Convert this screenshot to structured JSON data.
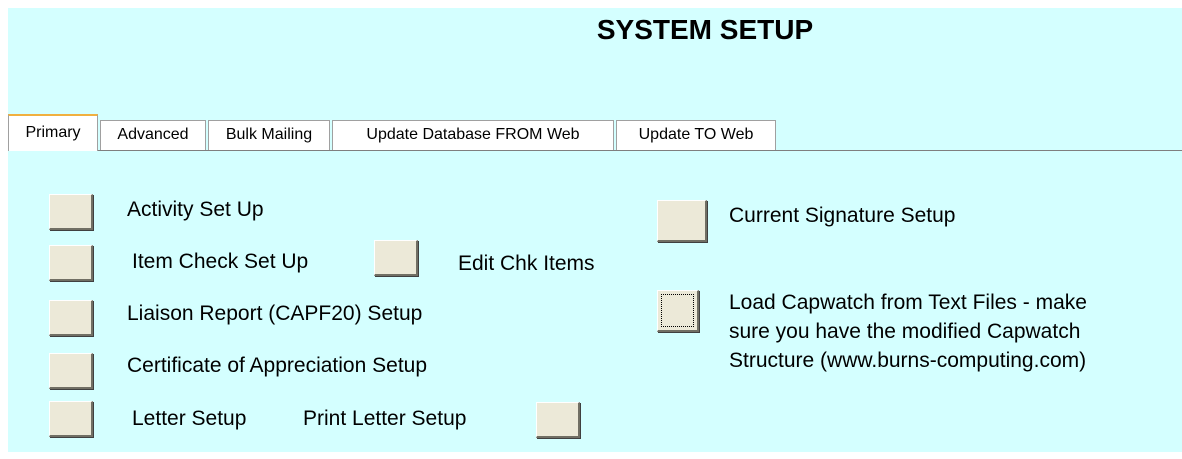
{
  "window": {
    "title": "SYSTEM SETUP"
  },
  "tabs": [
    {
      "label": "Primary",
      "active": true
    },
    {
      "label": "Advanced",
      "active": false
    },
    {
      "label": "Bulk Mailing",
      "active": false
    },
    {
      "label": "Update Database FROM Web",
      "active": false
    },
    {
      "label": "Update TO Web",
      "active": false
    }
  ],
  "primary": {
    "activity_label": "Activity Set Up",
    "item_check_label": "Item Check Set Up",
    "edit_chk_items_label": "Edit Chk Items",
    "liaison_label": "Liaison Report (CAPF20) Setup",
    "certificate_label": "Certificate of  Appreciation Setup",
    "letter_label": "Letter Setup",
    "print_letter_label": "Print Letter Setup",
    "signature_label": "Current Signature Setup",
    "capwatch_label": "Load Capwatch from Text Files - make sure you have the modified Capwatch Structure (www.burns-computing.com)"
  },
  "colors": {
    "background": "#d4ffff",
    "button_face": "#ece9d8",
    "active_tab_accent": "#f0b040"
  }
}
